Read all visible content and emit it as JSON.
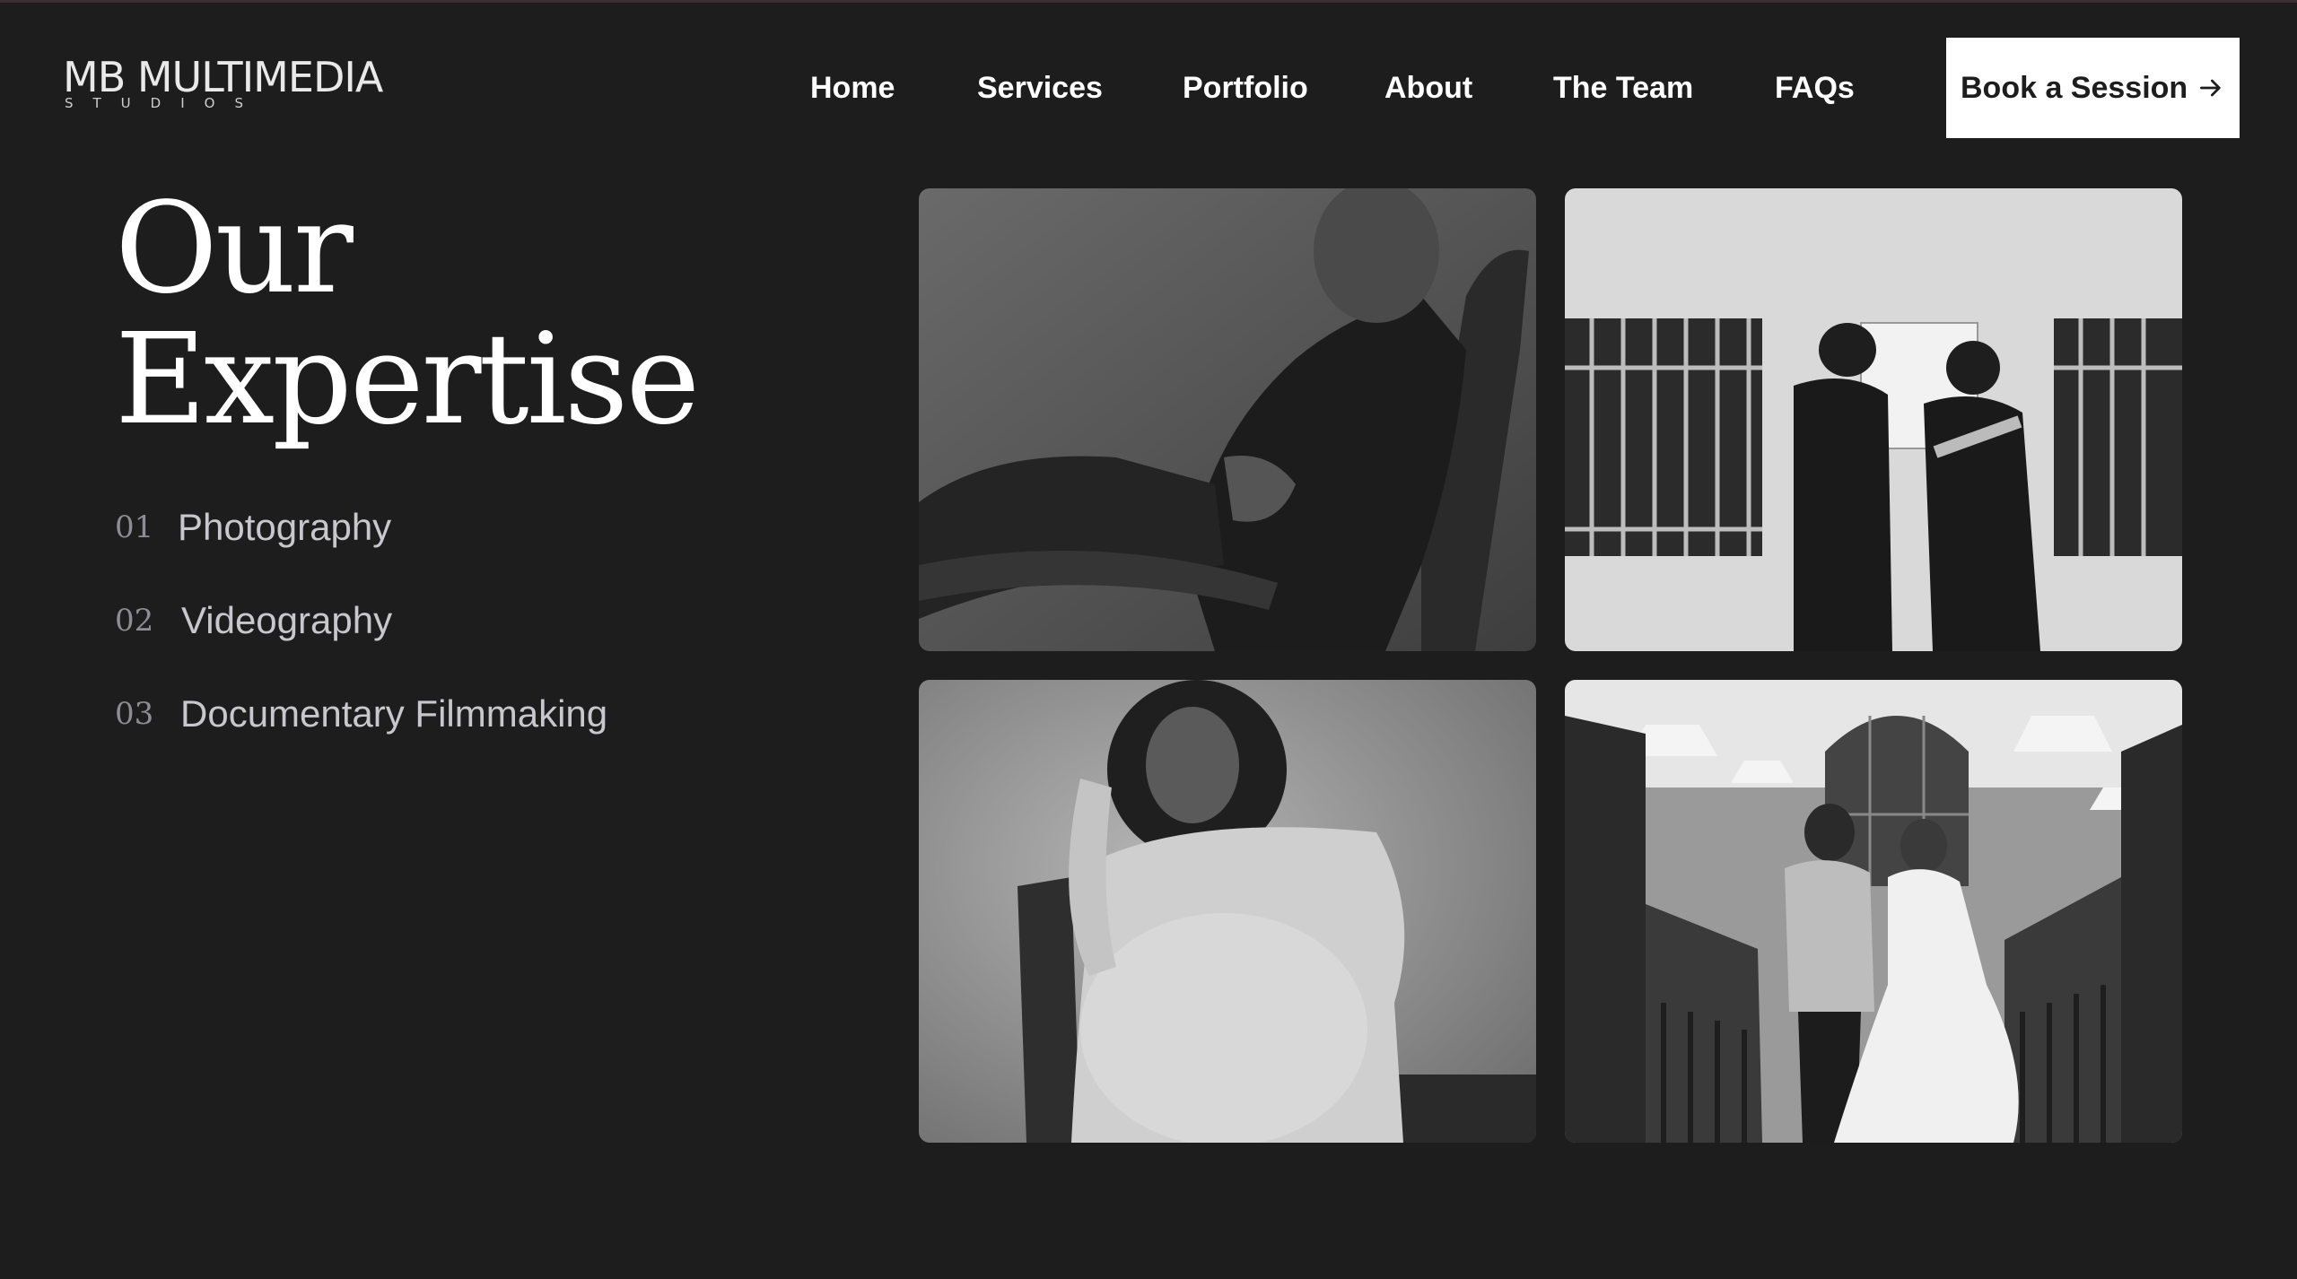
{
  "brand": {
    "logo_main": "MB MULTIMEDIA",
    "logo_sub": "STUDIOS"
  },
  "nav": {
    "items": [
      {
        "label": "Home"
      },
      {
        "label": "Services"
      },
      {
        "label": "Portfolio"
      },
      {
        "label": "About"
      },
      {
        "label": "The Team"
      },
      {
        "label": "FAQs"
      }
    ],
    "cta_label": "Book a Session",
    "cta_icon": "arrow-right-icon"
  },
  "section": {
    "title_line1": "Our",
    "title_line2": "Expertise",
    "items": [
      {
        "number": "01",
        "label": "Photography"
      },
      {
        "number": "02",
        "label": "Videography"
      },
      {
        "number": "03",
        "label": "Documentary Filmmaking"
      }
    ]
  },
  "gallery": {
    "images": [
      {
        "name": "portrait-man-in-chair"
      },
      {
        "name": "workers-at-wall-plaque"
      },
      {
        "name": "maternity-portrait"
      },
      {
        "name": "wedding-couple-church-aisle"
      }
    ]
  },
  "colors": {
    "background": "#1d1d1e",
    "text": "#ffffff",
    "muted_text": "#c7c7cc",
    "number_text": "#8d8d93",
    "cta_background": "#ffffff",
    "cta_text": "#1d1d1e"
  }
}
